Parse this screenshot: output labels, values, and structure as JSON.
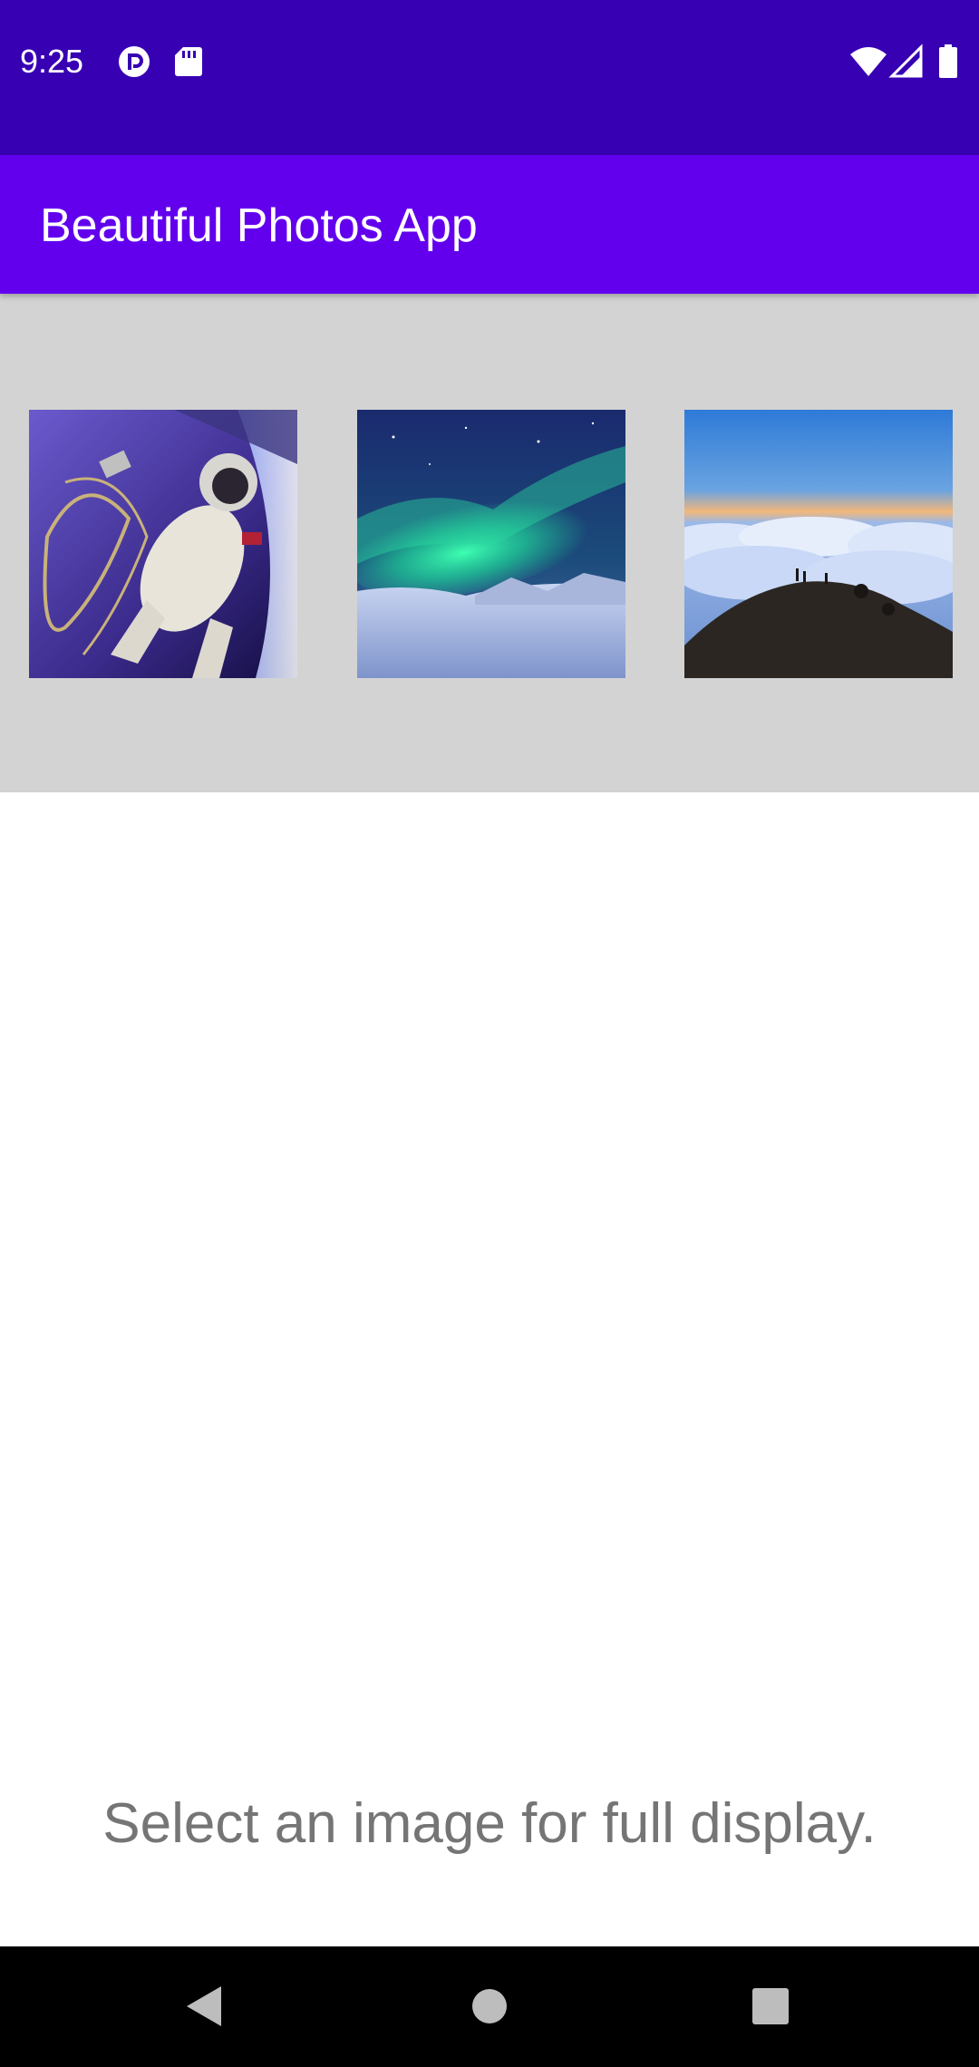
{
  "status_bar": {
    "time": "9:25",
    "left_icons": [
      "podcast-icon",
      "sd-card-icon"
    ],
    "right_icons": [
      "wifi-icon",
      "cell-signal-icon",
      "battery-icon"
    ],
    "background": "#3700b3"
  },
  "app_bar": {
    "title": "Beautiful Photos App",
    "background": "#6200ee"
  },
  "gallery": {
    "background": "#d3d3d3",
    "thumbnails": [
      {
        "subject": "astronaut-spacewalk"
      },
      {
        "subject": "aurora-borealis"
      },
      {
        "subject": "sea-of-clouds-summit"
      }
    ]
  },
  "main": {
    "hint": "Select an image for full display."
  },
  "nav_bar": {
    "buttons": [
      "back-icon",
      "home-icon",
      "recents-icon"
    ]
  }
}
